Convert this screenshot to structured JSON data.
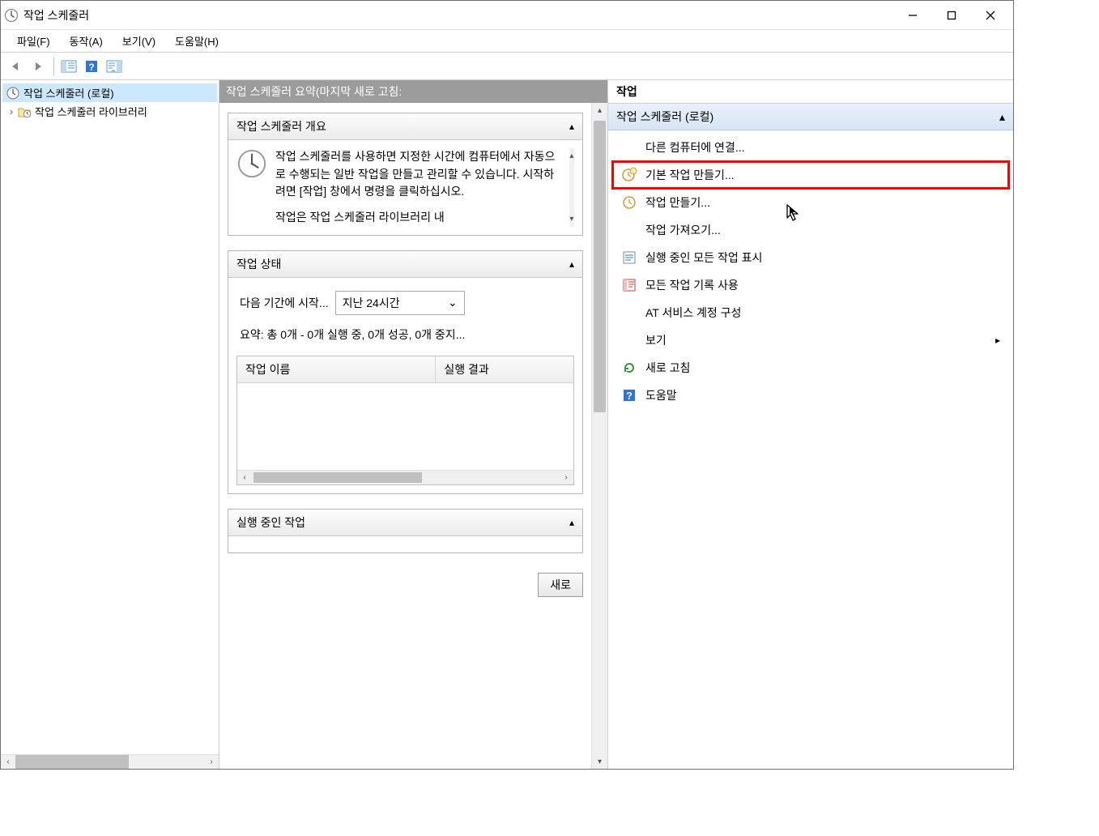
{
  "window": {
    "title": "작업 스케줄러"
  },
  "menu": {
    "file": "파일(F)",
    "action": "동작(A)",
    "view": "보기(V)",
    "help": "도움말(H)"
  },
  "tree": {
    "root": "작업 스케줄러 (로컬)",
    "library": "작업 스케줄러 라이브러리"
  },
  "center": {
    "header": "작업 스케줄러 요약(마지막 새로 고침:",
    "overview_title": "작업 스케줄러 개요",
    "overview_text": "작업 스케줄러를 사용하면 지정한 시간에 컴퓨터에서 자동으로 수행되는 일반 작업을 만들고 관리할 수 있습니다. 시작하려면 [작업] 창에서 명령을 클릭하십시오.",
    "overview_text2": "작업은 작업 스케줄러 라이브러리 내",
    "status_title": "작업 상태",
    "status_label": "다음 기간에 시작...",
    "status_select": "지난 24시간",
    "status_summary": "요약: 총 0개 - 0개 실행 중, 0개 성공, 0개 중지...",
    "task_name_col": "작업 이름",
    "task_result_col": "실행 결과",
    "running_title": "실행 중인 작업",
    "refresh_btn": "새로"
  },
  "actions": {
    "header": "작업",
    "subheader": "작업 스케줄러 (로컬)",
    "items": {
      "connect": "다른 컴퓨터에 연결...",
      "create_basic": "기본 작업 만들기...",
      "create": "작업 만들기...",
      "import": "작업 가져오기...",
      "show_running": "실행 중인 모든 작업 표시",
      "enable_history": "모든 작업 기록 사용",
      "at_account": "AT 서비스 계정 구성",
      "view": "보기",
      "refresh": "새로 고침",
      "help": "도움말"
    }
  }
}
